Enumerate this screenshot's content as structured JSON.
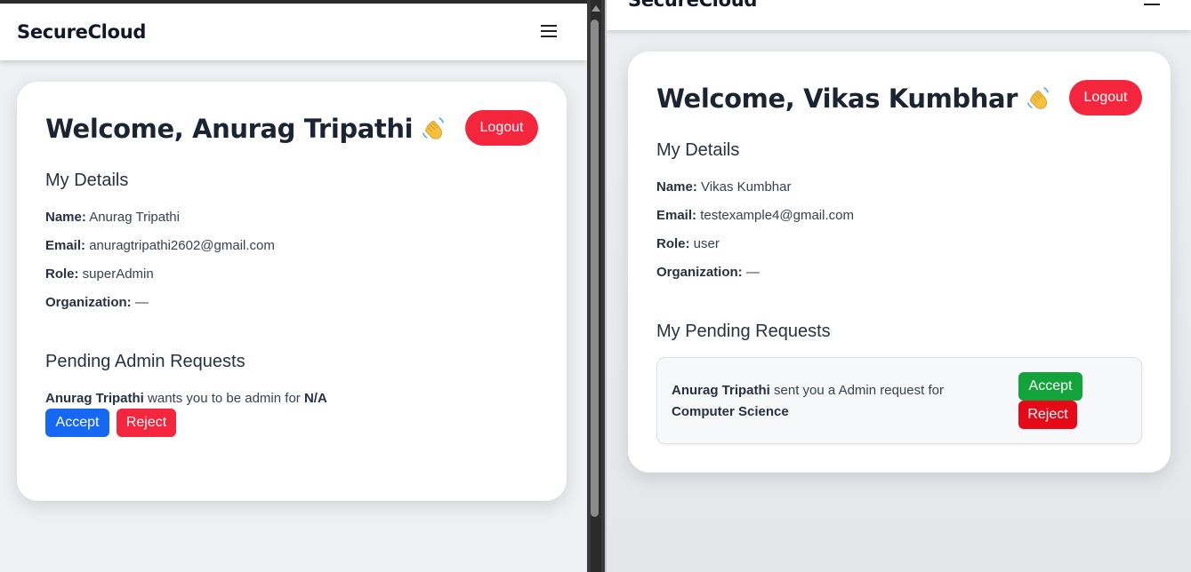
{
  "left": {
    "brand": "SecureCloud",
    "welcome": "Welcome, Anurag Tripathi",
    "logout_label": "Logout",
    "details_title": "My Details",
    "details": [
      {
        "label": "Name:",
        "value": "Anurag Tripathi"
      },
      {
        "label": "Email:",
        "value": "anuragtripathi2602@gmail.com"
      },
      {
        "label": "Role:",
        "value": "superAdmin"
      },
      {
        "label": "Organization:",
        "value": "—"
      }
    ],
    "pending_title": "Pending Admin Requests",
    "request": {
      "from": "Anurag Tripathi",
      "text": "wants you to be admin for",
      "target": "N/A"
    },
    "accept_label": "Accept",
    "reject_label": "Reject"
  },
  "right": {
    "brand": "SecureCloud",
    "welcome": "Welcome, Vikas Kumbhar",
    "logout_label": "Logout",
    "details_title": "My Details",
    "details": [
      {
        "label": "Name:",
        "value": "Vikas Kumbhar"
      },
      {
        "label": "Email:",
        "value": "testexample4@gmail.com"
      },
      {
        "label": "Role:",
        "value": "user"
      },
      {
        "label": "Organization:",
        "value": "—"
      }
    ],
    "pending_title": "My Pending Requests",
    "request": {
      "from": "Anurag Tripathi",
      "text": "sent you a Admin request for",
      "target": "Computer Science"
    },
    "accept_label": "Accept",
    "reject_label": "Reject"
  },
  "icons": {
    "menu": "hamburger-menu-icon",
    "wave": "waving-hand-icon"
  },
  "colors": {
    "logout": "#f3263d",
    "accept_blue": "#1668f2",
    "accept_green": "#12a33a",
    "reject": "#e60a18"
  }
}
